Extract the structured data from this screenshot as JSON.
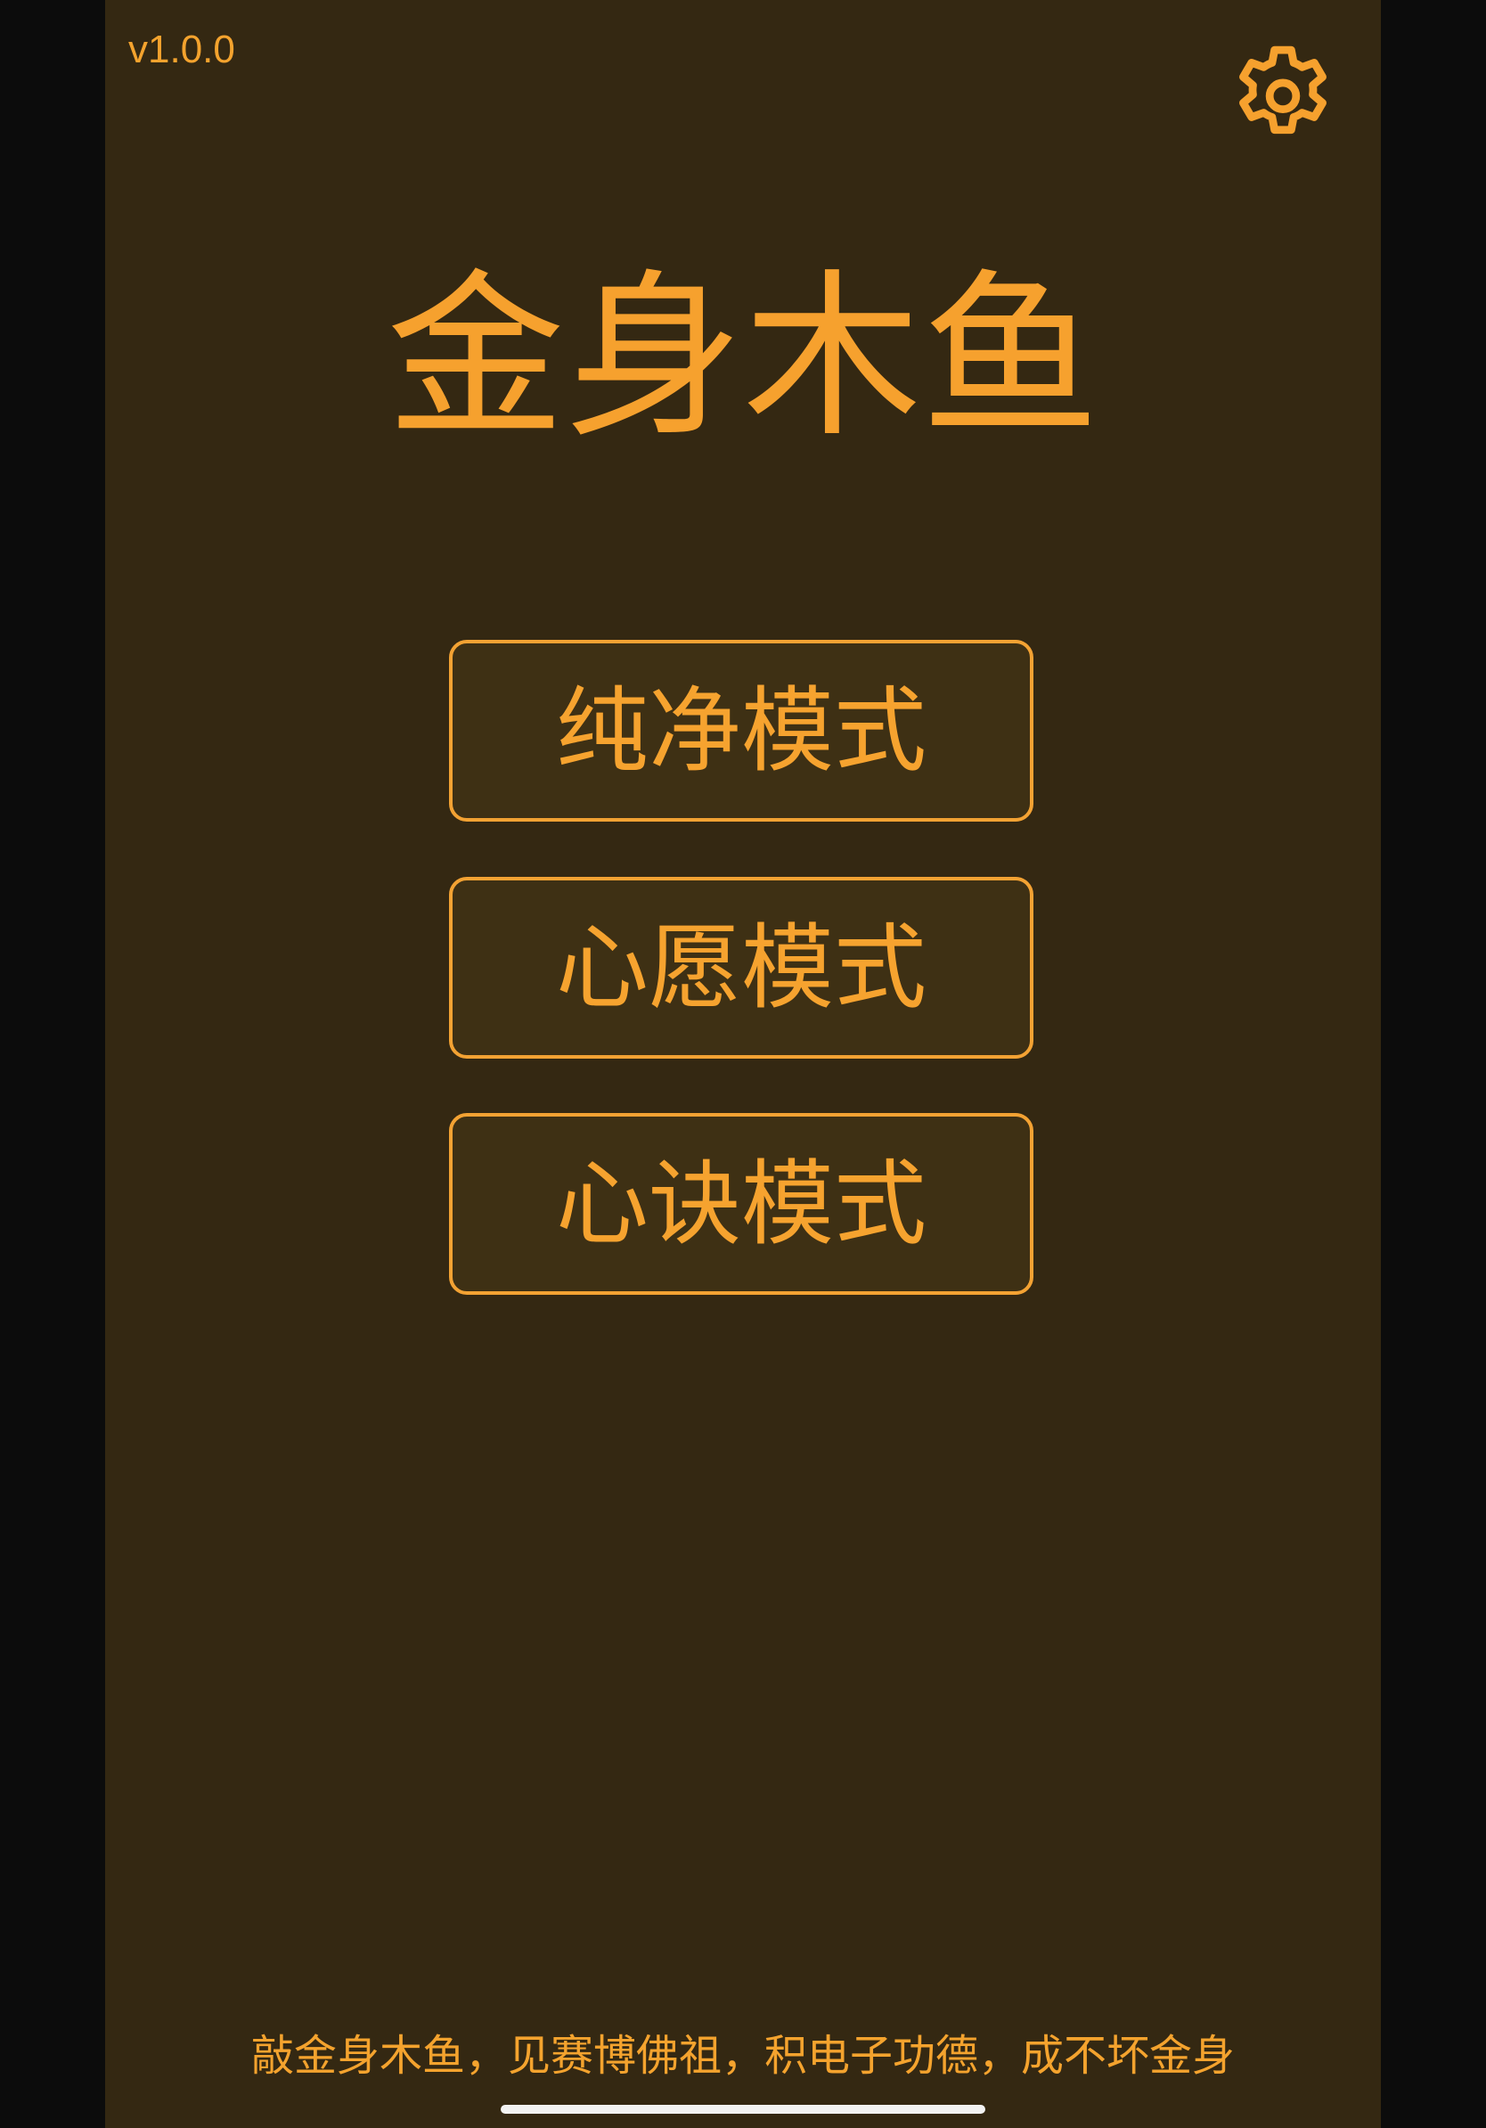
{
  "app": {
    "version": "v1.0.0",
    "title": "金身木鱼",
    "settings_icon": "gear-icon"
  },
  "modes": [
    {
      "label": "纯净模式"
    },
    {
      "label": "心愿模式"
    },
    {
      "label": "心诀模式"
    }
  ],
  "footer": {
    "slogan": "敲金身木鱼，见赛博佛祖，积电子功德，成不坏金身"
  },
  "colors": {
    "accent": "#f6a12e",
    "background": "#342812",
    "button_fill": "#3e3014",
    "outer_background": "#0c0c0c"
  }
}
